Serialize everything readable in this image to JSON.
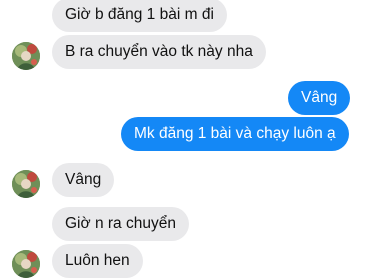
{
  "conversation": {
    "messages": [
      {
        "direction": "incoming",
        "text": "Giờ b đăng 1 bài m đi",
        "show_avatar": false
      },
      {
        "direction": "incoming",
        "text": "B ra chuyển vào tk này nha",
        "show_avatar": true
      },
      {
        "direction": "outgoing",
        "text": "Vâng",
        "show_avatar": false
      },
      {
        "direction": "outgoing",
        "text": "Mk đăng 1 bài và chạy luôn ạ",
        "show_avatar": false
      },
      {
        "direction": "incoming",
        "text": "Vâng",
        "show_avatar": true
      },
      {
        "direction": "incoming",
        "text": "Giờ n ra chuyển",
        "show_avatar": false
      },
      {
        "direction": "incoming",
        "text": "Luôn hen",
        "show_avatar": true
      }
    ]
  },
  "colors": {
    "incoming_bubble": "#e9e9eb",
    "outgoing_bubble": "#1488f6",
    "background": "#ffffff"
  },
  "icons": {
    "avatar": "contact-avatar-photo"
  }
}
